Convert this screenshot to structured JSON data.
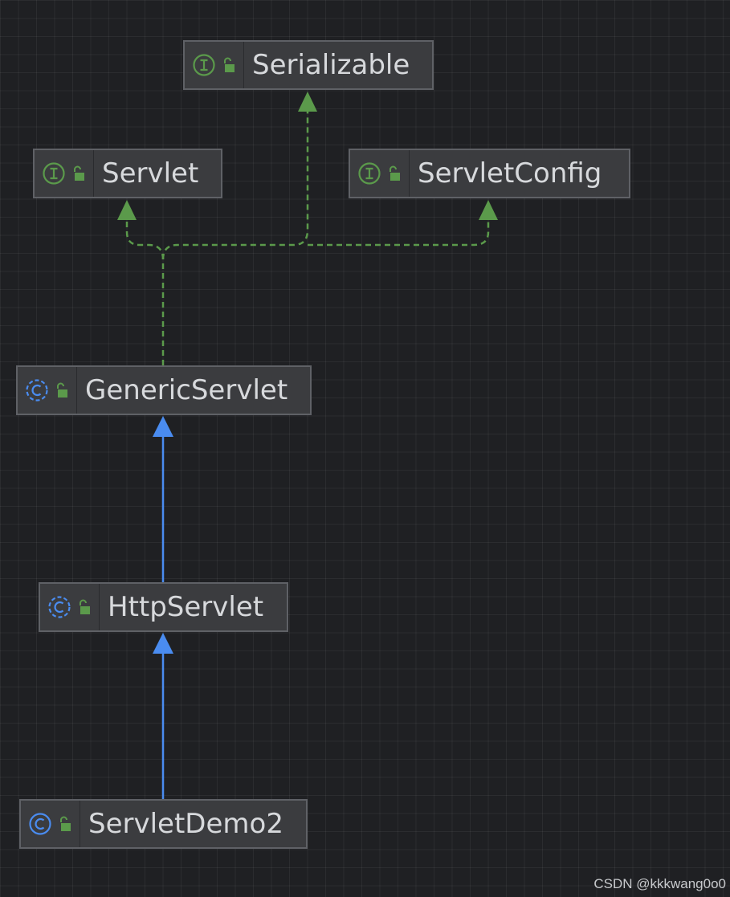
{
  "diagram": {
    "colors": {
      "background": "#1f2023",
      "interface": "#5b9a4b",
      "class": "#4a8cf0",
      "node_fill": "#3b3c3f",
      "node_border": "#5f6166",
      "text": "#d7d9dc"
    },
    "nodes": [
      {
        "id": "serializable",
        "label": "Serializable",
        "kind": "interface"
      },
      {
        "id": "servlet",
        "label": "Servlet",
        "kind": "interface"
      },
      {
        "id": "servletconfig",
        "label": "ServletConfig",
        "kind": "interface"
      },
      {
        "id": "genericservlet",
        "label": "GenericServlet",
        "kind": "class"
      },
      {
        "id": "httpservlet",
        "label": "HttpServlet",
        "kind": "class"
      },
      {
        "id": "servletdemo2",
        "label": "ServletDemo2",
        "kind": "class"
      }
    ],
    "edges": [
      {
        "from": "genericservlet",
        "to": "servlet",
        "type": "implements"
      },
      {
        "from": "genericservlet",
        "to": "serializable",
        "type": "implements"
      },
      {
        "from": "genericservlet",
        "to": "servletconfig",
        "type": "implements"
      },
      {
        "from": "httpservlet",
        "to": "genericservlet",
        "type": "extends"
      },
      {
        "from": "servletdemo2",
        "to": "httpservlet",
        "type": "extends"
      }
    ]
  },
  "watermark": "CSDN @kkkwang0o0"
}
